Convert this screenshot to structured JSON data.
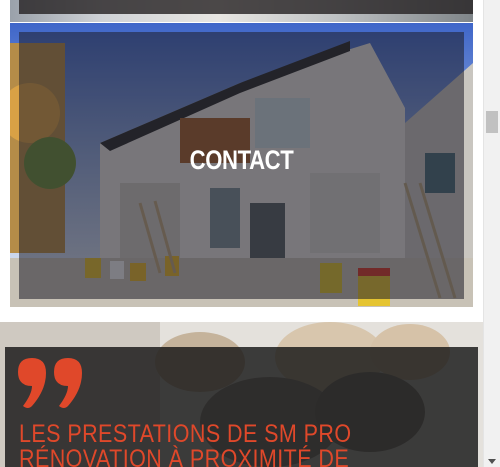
{
  "contact_card": {
    "title": "CONTACT"
  },
  "services_section": {
    "quote_icon": "quote-icon",
    "heading_line1": "LES PRESTATIONS DE SM PRO",
    "heading_line2": "RÉNOVATION À PROXIMITÉ DE"
  },
  "colors": {
    "accent": "#e0482a",
    "overlay": "#282426",
    "scrollbar_track": "#f1f1f1",
    "scrollbar_thumb": "#c1c1c1"
  },
  "scrollbar": {
    "icon_down": "arrow-down-icon"
  }
}
